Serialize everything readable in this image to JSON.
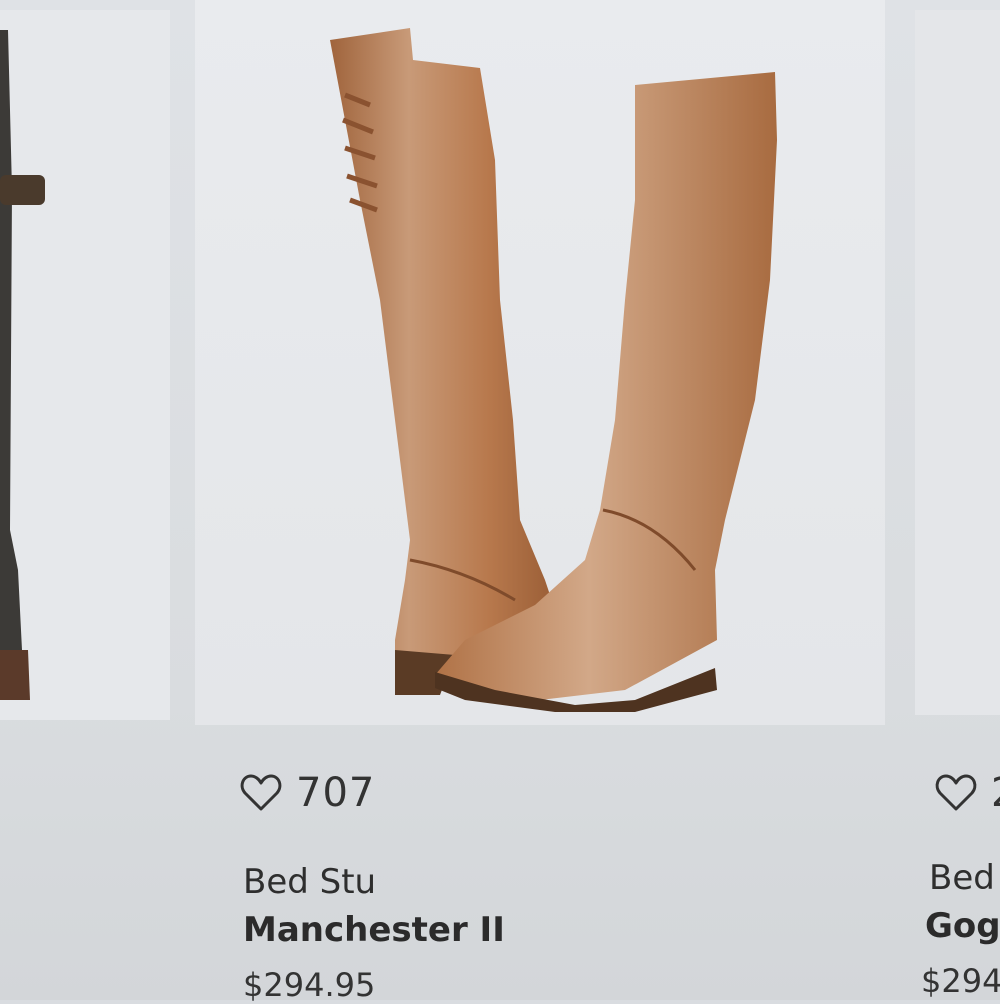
{
  "products": [
    {
      "id": "left",
      "partial": true,
      "image_icon": "boot-image"
    },
    {
      "id": "main",
      "favorites": "707",
      "brand": "Bed Stu",
      "name": "Manchester II",
      "price": "$294.95",
      "image_icon": "tall-leather-boots-image",
      "colors": {
        "leather": "#b5764a",
        "sole": "#5a3b25",
        "background": "#e6e8eb"
      }
    },
    {
      "id": "right",
      "partial": true,
      "favorites": "2",
      "brand": "Bed",
      "name": "Gog",
      "price": "$294"
    }
  ]
}
